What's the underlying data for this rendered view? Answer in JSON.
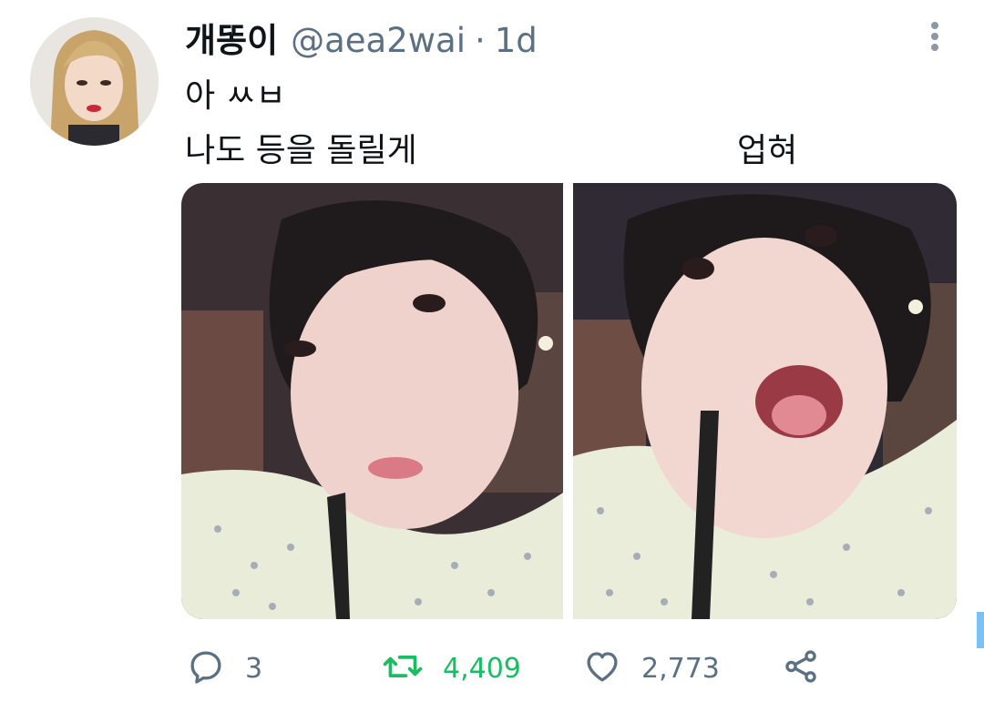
{
  "tweet": {
    "display_name": "개똥이",
    "handle": "@aea2wai",
    "separator": "·",
    "time": "1d",
    "text_line1": "아 ㅆㅂ",
    "text_line2_left": "나도 등을 돌릴게",
    "text_line2_right": "업혀"
  },
  "actions": {
    "reply_count": "3",
    "retweet_count": "4,409",
    "like_count": "2,773"
  },
  "colors": {
    "retweet_active": "#17bf63",
    "muted": "#5b7083",
    "scrollbar": "#7bc1f5"
  },
  "icons": [
    "more-vertical-icon",
    "reply-icon",
    "retweet-icon",
    "like-icon",
    "share-icon"
  ]
}
